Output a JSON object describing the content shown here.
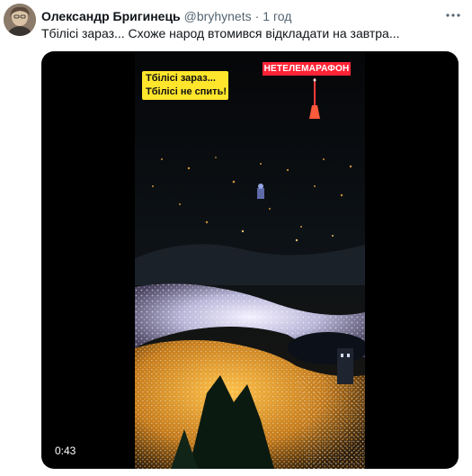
{
  "tweet": {
    "author_name": "Олександр Бригинець",
    "handle": "@bryhynets",
    "separator": "·",
    "time": "1 год",
    "text": "Тбілісі зараз... Схоже народ втомився відкладати на завтра...",
    "more_icon": "more-dots-icon"
  },
  "video": {
    "caption_line1": "Тбілісі зараз...",
    "caption_line2": "Тбілісі не спить!",
    "channel_label": "НЕТЕЛЕМАРАФОН",
    "duration": "0:43"
  },
  "colors": {
    "text": "#0f1419",
    "secondary": "#536471",
    "caption_bg": "#ffe52b",
    "channel_bg": "#ff2436"
  }
}
